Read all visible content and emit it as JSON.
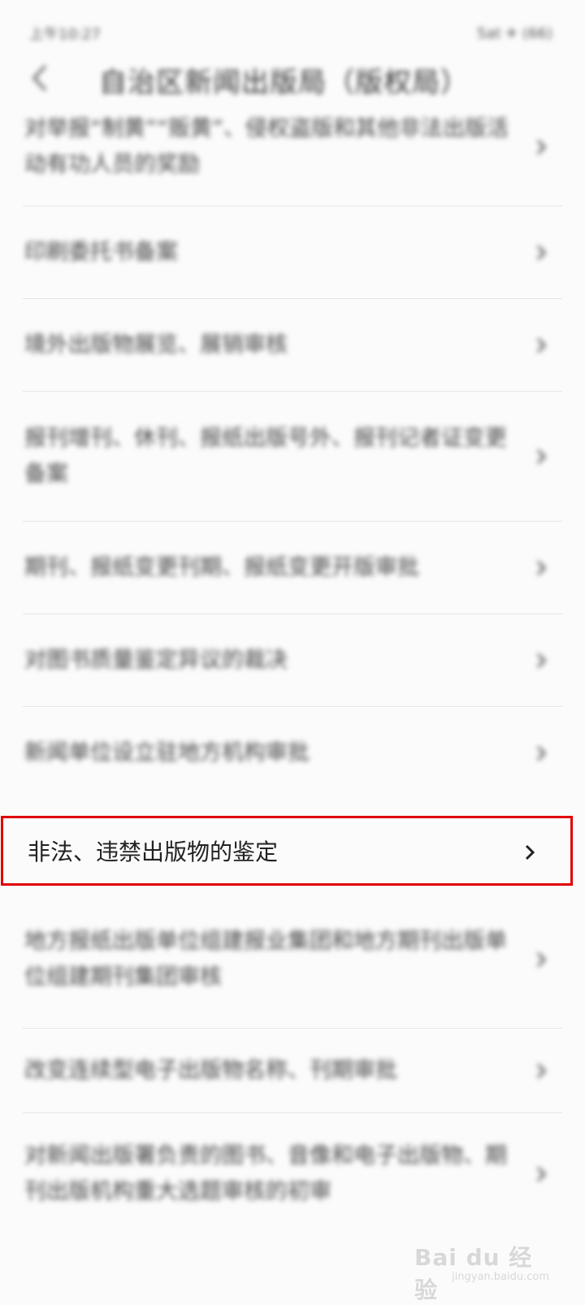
{
  "status_bar": {
    "time": "上午10:27",
    "right": "5at ✈ (66)"
  },
  "header": {
    "title": "自治区新闻出版局（版权局）"
  },
  "items": [
    {
      "label": "对举报“制黄”“贩黄”、侵权盗版和其他非法出版活动有功人员的奖励"
    },
    {
      "label": "印刷委托书备案"
    },
    {
      "label": "境外出版物展览、展销审核"
    },
    {
      "label": "报刊增刊、休刊、报纸出版号外、报刊记者证变更备案"
    },
    {
      "label": "期刊、报纸变更刊期、报纸变更开版审批"
    },
    {
      "label": "对图书质量鉴定异议的裁决"
    },
    {
      "label": "新闻单位设立驻地方机构审批"
    },
    {
      "label": "非法、违禁出版物的鉴定"
    },
    {
      "label": "地方报纸出版单位组建报业集团和地方期刊出版单位组建期刊集团审核"
    },
    {
      "label": "改变连续型电子出版物名称、刊期审批"
    },
    {
      "label": "对新闻出版署负责的图书、音像和电子出版物、期刊出版机构重大选题审核的初审"
    }
  ],
  "watermark": {
    "main": "Bai du 经验",
    "sub": "jingyan.baidu.com"
  }
}
